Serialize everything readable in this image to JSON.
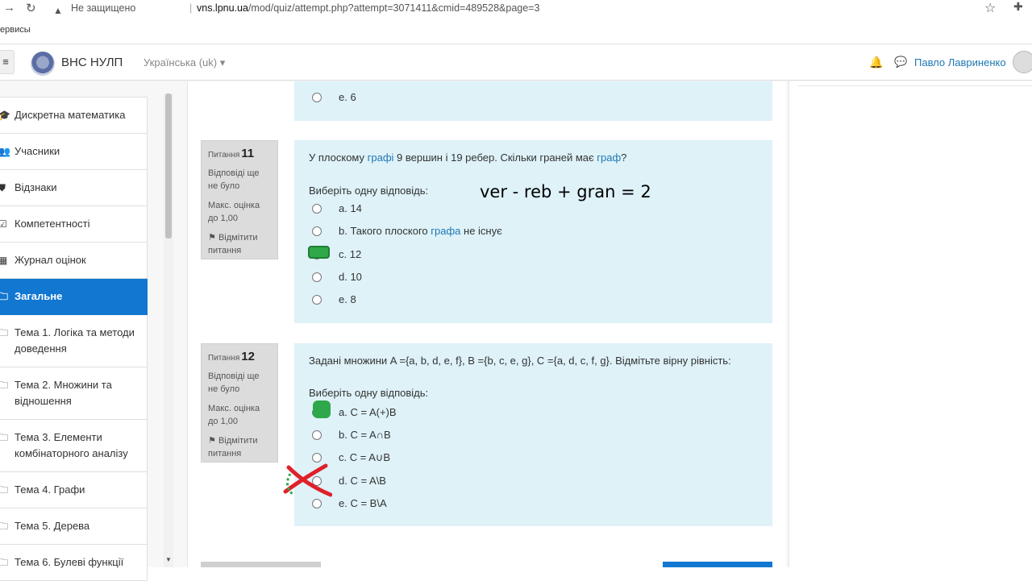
{
  "browser": {
    "security_label": "Не защищено",
    "url_host": "vns.lpnu.ua",
    "url_path": "/mod/quiz/attempt.php?attempt=3071411&cmid=489528&page=3",
    "bookmarks_label": "ервисы"
  },
  "navbar": {
    "brand": "ВНС НУЛП",
    "language": "Українська (uk) ▾",
    "user_name": "Павло Лавриненко"
  },
  "sidebar": {
    "items": [
      {
        "label": "Дискретна математика",
        "icon": "graduation-cap-icon",
        "glyph": "🎓"
      },
      {
        "label": "Учасники",
        "icon": "users-icon",
        "glyph": "👥"
      },
      {
        "label": "Відзнаки",
        "icon": "shield-icon",
        "glyph": "⛊"
      },
      {
        "label": "Компетентності",
        "icon": "checkbox-icon",
        "glyph": "☑"
      },
      {
        "label": "Журнал оцінок",
        "icon": "table-icon",
        "glyph": "▦"
      },
      {
        "label": "Загальне",
        "icon": "folder-icon",
        "glyph": "🗀"
      },
      {
        "label": "Тема 1. Логіка та методи доведення",
        "icon": "folder-icon",
        "glyph": "🗀"
      },
      {
        "label": "Тема 2. Множини та відношення",
        "icon": "folder-icon",
        "glyph": "🗀"
      },
      {
        "label": "Тема 3. Елементи комбінаторного аналізу",
        "icon": "folder-icon",
        "glyph": "🗀"
      },
      {
        "label": "Тема 4. Графи",
        "icon": "folder-icon",
        "glyph": "🗀"
      },
      {
        "label": "Тема 5. Дерева",
        "icon": "folder-icon",
        "glyph": "🗀"
      },
      {
        "label": "Тема 6. Булеві функції",
        "icon": "folder-icon",
        "glyph": "🗀"
      }
    ],
    "active_index": 5
  },
  "prev_question": {
    "last_option": "e. 6"
  },
  "q11": {
    "label": "Питання",
    "number": "11",
    "status": "Відповіді ще не було",
    "max_grade": "Макс. оцінка до 1,00",
    "flag": "Відмітити питання",
    "text_part1": "У плоскому ",
    "text_link1": "графі",
    "text_part2": " 9 вершин і 19 ребер. Скільки граней має ",
    "text_link2": "граф",
    "text_part3": "?",
    "prompt": "Виберіть одну відповідь:",
    "options": [
      "a. 14",
      "b. Такого плоского ",
      "c. 12",
      "d. 10",
      "e. 8"
    ],
    "option_b_link": "графа",
    "option_b_tail": " не існує",
    "handwritten_note": "ver - reb + gran = 2"
  },
  "q12": {
    "label": "Питання",
    "number": "12",
    "status": "Відповіді ще не було",
    "max_grade": "Макс. оцінка до 1,00",
    "flag": "Відмітити питання",
    "text": "Задані множини A ={a, b, d, e, f}, B ={b, c, e, g}, C ={a, d, c, f, g}. Відмітьте вірну рівність:",
    "prompt": "Виберіть одну відповідь:",
    "options": [
      "a. C = A(+)B",
      "b. C = A∩B",
      "c. C = A∪B",
      "d. C = A\\B",
      "e. C = B\\A"
    ]
  }
}
